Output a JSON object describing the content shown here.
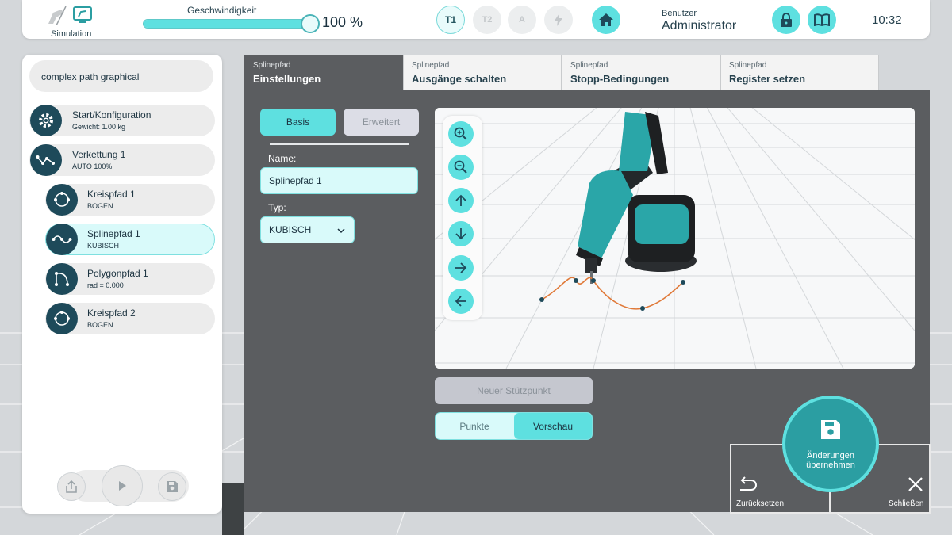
{
  "colors": {
    "accent": "#5ee0e0",
    "dark_teal": "#1e4a5a",
    "panel": "#5b5d60",
    "save": "#2b9ea2"
  },
  "topbar": {
    "mode_label": "Simulation",
    "speed_label": "Geschwindigkeit",
    "speed_value": "100 %",
    "speed_fraction": 1.0,
    "modes": [
      "T1",
      "T2",
      "A"
    ],
    "user_caption": "Benutzer",
    "user_name": "Administrator",
    "time": "10:32",
    "icons": [
      "robot-icon",
      "monitor-icon",
      "lightning-icon",
      "home-icon",
      "lock-icon",
      "manual-icon"
    ]
  },
  "sidebar": {
    "program_name": "complex path graphical",
    "items": [
      {
        "title": "Start/Konfiguration",
        "sub": "Gewicht: 1.00 kg",
        "icon": "gear-icon"
      },
      {
        "title": "Verkettung 1",
        "sub": "AUTO  100%",
        "icon": "chain-path-icon"
      },
      {
        "title": "Kreispfad 1",
        "sub": "BOGEN",
        "icon": "circle-path-icon"
      },
      {
        "title": "Splinepfad 1",
        "sub": "KUBISCH",
        "icon": "spline-path-icon",
        "selected": true
      },
      {
        "title": "Polygonpfad 1",
        "sub": "rad = 0.000",
        "icon": "polygon-path-icon"
      },
      {
        "title": "Kreispfad 2",
        "sub": "BOGEN",
        "icon": "circle-path-icon"
      }
    ],
    "bottom_icons": [
      "export-icon",
      "play-icon",
      "save-icon"
    ]
  },
  "tabs": [
    {
      "small": "Splinepfad",
      "label": "Einstellungen",
      "active": true
    },
    {
      "small": "Splinepfad",
      "label": "Ausgänge schalten"
    },
    {
      "small": "Splinepfad",
      "label": "Stopp-Bedingungen"
    },
    {
      "small": "Splinepfad",
      "label": "Register setzen"
    }
  ],
  "settings": {
    "tab_basis": "Basis",
    "tab_advanced": "Erweitert",
    "name_label": "Name:",
    "name_value": "Splinepfad 1",
    "type_label": "Typ:",
    "type_value": "KUBISCH"
  },
  "viewport": {
    "controls": [
      "zoom-in-icon",
      "zoom-out-icon",
      "arrow-up-icon",
      "arrow-down-icon",
      "arrow-right-icon",
      "arrow-left-icon"
    ],
    "new_point_label": "Neuer Stützpunkt",
    "toggle_points": "Punkte",
    "toggle_preview": "Vorschau"
  },
  "actions": {
    "save_label_line1": "Änderungen",
    "save_label_line2": "übernehmen",
    "reset_label": "Zurücksetzen",
    "close_label": "Schließen"
  }
}
